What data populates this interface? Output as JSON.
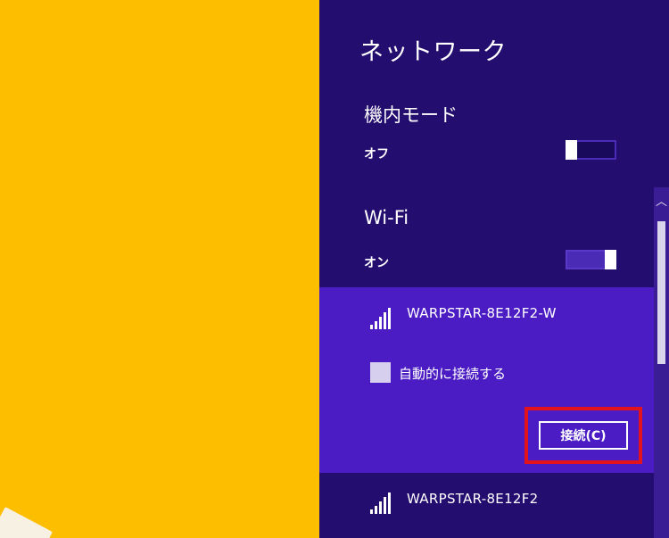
{
  "panel": {
    "title": "ネットワーク"
  },
  "airplane": {
    "label": "機内モード",
    "state": "オフ"
  },
  "wifi": {
    "label": "Wi-Fi",
    "state": "オン"
  },
  "networks": [
    {
      "name": "WARPSTAR-8E12F2-W",
      "auto_connect_label": "自動的に接続する",
      "connect_label": "接続(C)"
    },
    {
      "name": "WARPSTAR-8E12F2"
    }
  ],
  "colors": {
    "panel_bg": "#230d6e",
    "selected_bg": "#4b1cc3",
    "highlight": "#e3131e",
    "desktop_bg": "#fdbe00"
  },
  "icons": {
    "signal": "wifi-signal-icon",
    "scroll_up": "chevron-up-icon"
  }
}
